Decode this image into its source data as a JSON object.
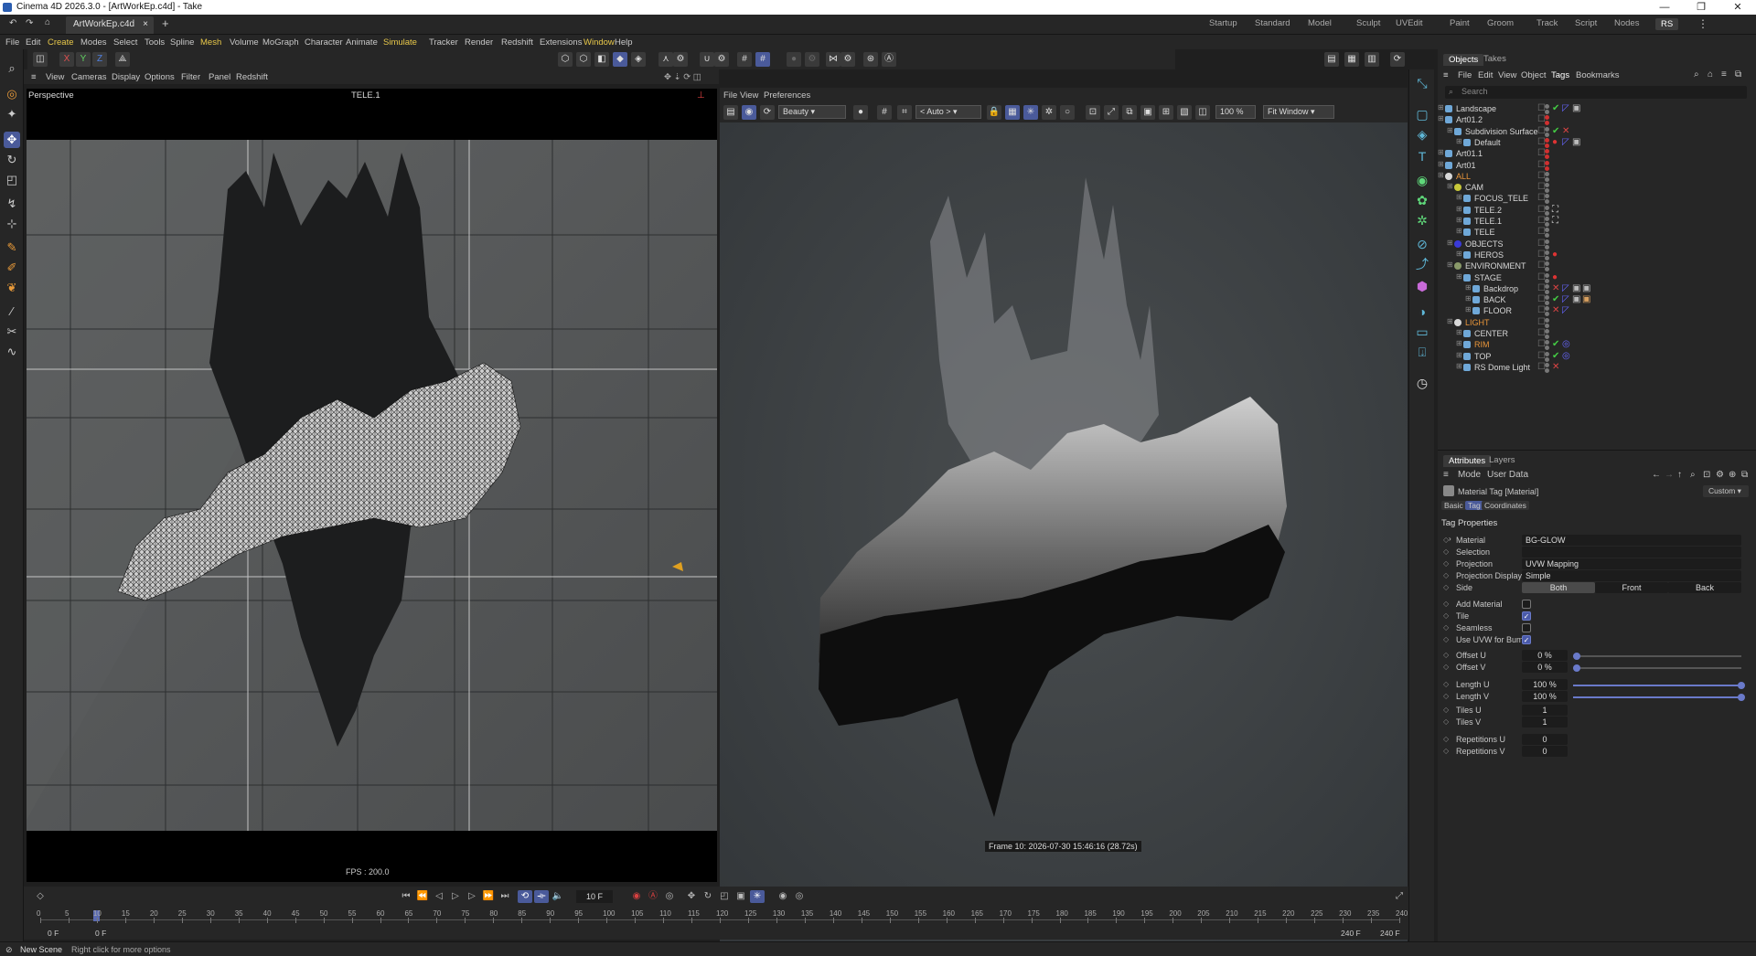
{
  "app": {
    "title": "Cinema 4D 2026.3.0 - [ArtWorkEp.c4d] - Take"
  },
  "doc_tab": {
    "name": "ArtWorkEp.c4d",
    "close": "×",
    "add": "+"
  },
  "layouts": [
    "Startup",
    "Standard",
    "Model",
    "Sculpt",
    "UVEdit",
    "Paint",
    "Groom",
    "Track",
    "Script",
    "Nodes",
    "RS"
  ],
  "menu": [
    "File",
    "Edit",
    "Create",
    "Modes",
    "Select",
    "Tools",
    "Spline",
    "Mesh",
    "Volume",
    "MoGraph",
    "Character",
    "Animate",
    "Simulate",
    "Tracker",
    "Render",
    "Redshift",
    "Extensions",
    "Window",
    "Help"
  ],
  "highlight_menus": [
    "Create",
    "Mesh",
    "Simulate",
    "Window"
  ],
  "toolbar": {
    "axis_x": "X",
    "axis_y": "Y",
    "axis_z": "Z"
  },
  "viewport1": {
    "menu": [
      "View",
      "Cameras",
      "Display",
      "Options",
      "Filter",
      "Panel",
      "Redshift"
    ],
    "label": "Perspective",
    "camera": "TELE.1",
    "fps": "FPS : 200.0"
  },
  "viewport2": {
    "menu": [
      "File",
      "View",
      "Preferences"
    ],
    "aov": "Beauty",
    "auto": "< Auto >",
    "zoom": "100 %",
    "fit": "Fit Window",
    "frame_info": "Frame  10:  2026-07-30  15:46:16  (28.72s)"
  },
  "objects_panel": {
    "tabs": [
      "Objects",
      "Takes"
    ],
    "menu": [
      "File",
      "Edit",
      "View",
      "Object",
      "Tags",
      "Bookmarks"
    ],
    "search_placeholder": "Search",
    "items": [
      {
        "name": "Landscape",
        "indent": 0,
        "color": "#d8d8d8"
      },
      {
        "name": "Art01.2",
        "indent": 0,
        "color": "#d8d8d8"
      },
      {
        "name": "Subdivision Surface",
        "indent": 1,
        "color": "#d8d8d8"
      },
      {
        "name": "Default",
        "indent": 2,
        "color": "#d8d8d8"
      },
      {
        "name": "Art01.1",
        "indent": 0,
        "color": "#d8d8d8"
      },
      {
        "name": "Art01",
        "indent": 0,
        "color": "#d8d8d8"
      },
      {
        "name": "ALL",
        "indent": 0,
        "color": "#e8953a"
      },
      {
        "name": "CAM",
        "indent": 1,
        "color": "#d8d8d8"
      },
      {
        "name": "FOCUS_TELE",
        "indent": 2,
        "color": "#d8d8d8"
      },
      {
        "name": "TELE.2",
        "indent": 2,
        "color": "#d8d8d8"
      },
      {
        "name": "TELE.1",
        "indent": 2,
        "color": "#d8d8d8"
      },
      {
        "name": "TELE",
        "indent": 2,
        "color": "#d8d8d8"
      },
      {
        "name": "OBJECTS",
        "indent": 1,
        "color": "#d8d8d8"
      },
      {
        "name": "HEROS",
        "indent": 2,
        "color": "#d8d8d8"
      },
      {
        "name": "ENVIRONMENT",
        "indent": 1,
        "color": "#d8d8d8"
      },
      {
        "name": "STAGE",
        "indent": 2,
        "color": "#d8d8d8"
      },
      {
        "name": "Backdrop",
        "indent": 3,
        "color": "#d8d8d8"
      },
      {
        "name": "BACK",
        "indent": 3,
        "color": "#d8d8d8"
      },
      {
        "name": "FLOOR",
        "indent": 3,
        "color": "#d8d8d8"
      },
      {
        "name": "LIGHT",
        "indent": 1,
        "color": "#e8953a"
      },
      {
        "name": "CENTER",
        "indent": 2,
        "color": "#d8d8d8"
      },
      {
        "name": "RIM",
        "indent": 2,
        "color": "#e8953a"
      },
      {
        "name": "TOP",
        "indent": 2,
        "color": "#d8d8d8"
      },
      {
        "name": "RS Dome Light",
        "indent": 2,
        "color": "#d8d8d8"
      }
    ]
  },
  "attributes": {
    "tabs": [
      "Attributes",
      "Layers"
    ],
    "menu": [
      "Mode",
      "User Data"
    ],
    "title": "Material Tag [Material]",
    "preset": "Custom",
    "subtabs": [
      "Basic",
      "Tag",
      "Coordinates"
    ],
    "section": "Tag Properties",
    "material_label": "Material",
    "material_value": "BG-GLOW",
    "selection_label": "Selection",
    "projection_label": "Projection",
    "projection_value": "UVW Mapping",
    "projection_display_label": "Projection Display",
    "projection_display_value": "Simple",
    "side_label": "Side",
    "side_options": [
      "Both",
      "Front",
      "Back"
    ],
    "add_material": "Add Material",
    "tile": "Tile",
    "seamless": "Seamless",
    "use_uvw": "Use UVW for Bump",
    "offset_u": "Offset U",
    "offset_u_val": "0 %",
    "offset_v": "Offset V",
    "offset_v_val": "0 %",
    "length_u": "Length U",
    "length_u_val": "100 %",
    "length_v": "Length V",
    "length_v_val": "100 %",
    "tiles_u": "Tiles U",
    "tiles_u_val": "1",
    "tiles_v": "Tiles V",
    "tiles_v_val": "1",
    "rep_u": "Repetitions U",
    "rep_u_val": "0",
    "rep_v": "Repetitions V",
    "rep_v_val": "0"
  },
  "timeline": {
    "current_frame": "10 F",
    "start": "0 F",
    "start2": "0 F",
    "end": "240 F",
    "end2": "240 F",
    "ticks": [
      "0",
      "5",
      "10",
      "15",
      "20",
      "25",
      "30",
      "35",
      "40",
      "45",
      "50",
      "55",
      "60",
      "65",
      "70",
      "75",
      "80",
      "85",
      "90",
      "95",
      "100",
      "105",
      "110",
      "115",
      "120",
      "125",
      "130",
      "135",
      "140",
      "145",
      "150",
      "155",
      "160",
      "165",
      "170",
      "175",
      "180",
      "185",
      "190",
      "195",
      "200",
      "205",
      "210",
      "215",
      "220",
      "225",
      "230",
      "235",
      "240"
    ]
  },
  "status": {
    "title": "New Scene",
    "hint": "Right click for more options"
  }
}
